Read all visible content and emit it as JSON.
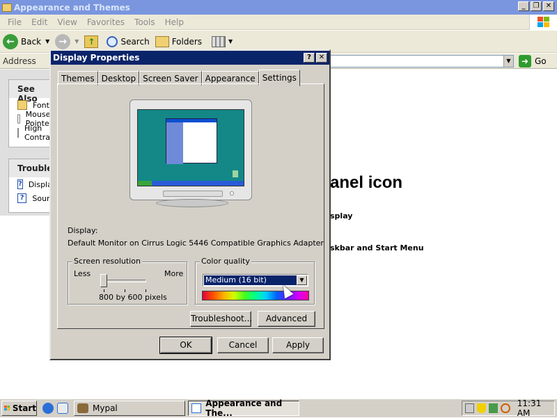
{
  "explorer": {
    "title": "Appearance and Themes",
    "menu": [
      "File",
      "Edit",
      "View",
      "Favorites",
      "Tools",
      "Help"
    ],
    "toolbar": {
      "back": "Back",
      "search": "Search",
      "folders": "Folders"
    },
    "address_label": "Address",
    "go_label": "Go",
    "see_also": {
      "header": "See Also",
      "items": [
        "Fonts",
        "Mouse Pointers",
        "High Contrast"
      ]
    },
    "troubleshooters": {
      "header": "Troubleshooters",
      "items": [
        "Display",
        "Sound"
      ]
    },
    "heading_fragment": "anel icon",
    "sub_fragment_1": "splay",
    "sub_fragment_2": "skbar and Start Menu"
  },
  "dialog": {
    "title": "Display Properties",
    "tabs": [
      "Themes",
      "Desktop",
      "Screen Saver",
      "Appearance",
      "Settings"
    ],
    "active_tab": "Settings",
    "display_label": "Display:",
    "display_value": "Default Monitor on Cirrus Logic 5446 Compatible Graphics Adapter",
    "screen_resolution": {
      "legend": "Screen resolution",
      "less": "Less",
      "more": "More",
      "value": "800 by 600 pixels"
    },
    "color_quality": {
      "legend": "Color quality",
      "selected": "Medium (16 bit)"
    },
    "buttons": {
      "troubleshoot": "Troubleshoot...",
      "advanced": "Advanced",
      "ok": "OK",
      "cancel": "Cancel",
      "apply": "Apply"
    }
  },
  "taskbar": {
    "start": "Start",
    "tasks": [
      "Mypal",
      "Appearance and The..."
    ],
    "clock": "11:31 AM"
  }
}
